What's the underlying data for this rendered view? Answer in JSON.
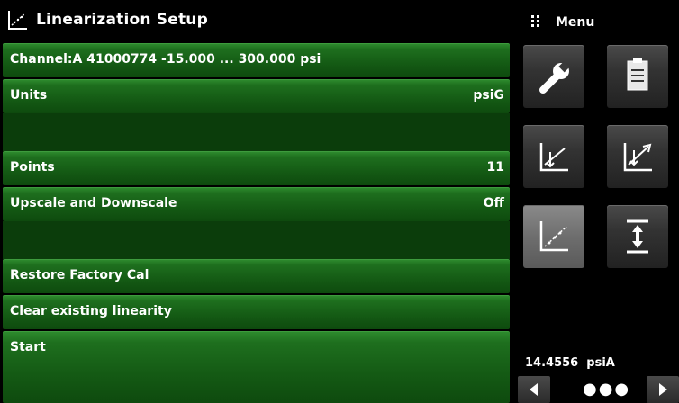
{
  "header": {
    "title": "Linearization Setup",
    "icon": "linearization-icon"
  },
  "rows": {
    "channel": {
      "label": "Channel:A  41000774  -15.000 ... 300.000 psi",
      "value": ""
    },
    "units": {
      "label": "Units",
      "value": "psiG"
    },
    "points": {
      "label": "Points",
      "value": "11"
    },
    "updown": {
      "label": "Upscale and Downscale",
      "value": "Off"
    },
    "restore": {
      "label": "Restore Factory Cal"
    },
    "clear": {
      "label": "Clear existing linearity"
    },
    "start": {
      "label": "Start"
    }
  },
  "menu": {
    "label": "Menu",
    "tiles": [
      {
        "icon": "wrench-icon"
      },
      {
        "icon": "document-icon"
      },
      {
        "icon": "calibrate-zero-icon"
      },
      {
        "icon": "calibrate-span-icon"
      },
      {
        "icon": "linearization-icon",
        "active": true
      },
      {
        "icon": "tare-icon"
      }
    ]
  },
  "status": {
    "reading": "14.4556",
    "unit": "psiA"
  },
  "nav": {
    "dots": "●●●"
  },
  "colors": {
    "row_green": "#1e6f1e",
    "tile_gray": "#333333",
    "active_tile": "#6e6e6e"
  }
}
